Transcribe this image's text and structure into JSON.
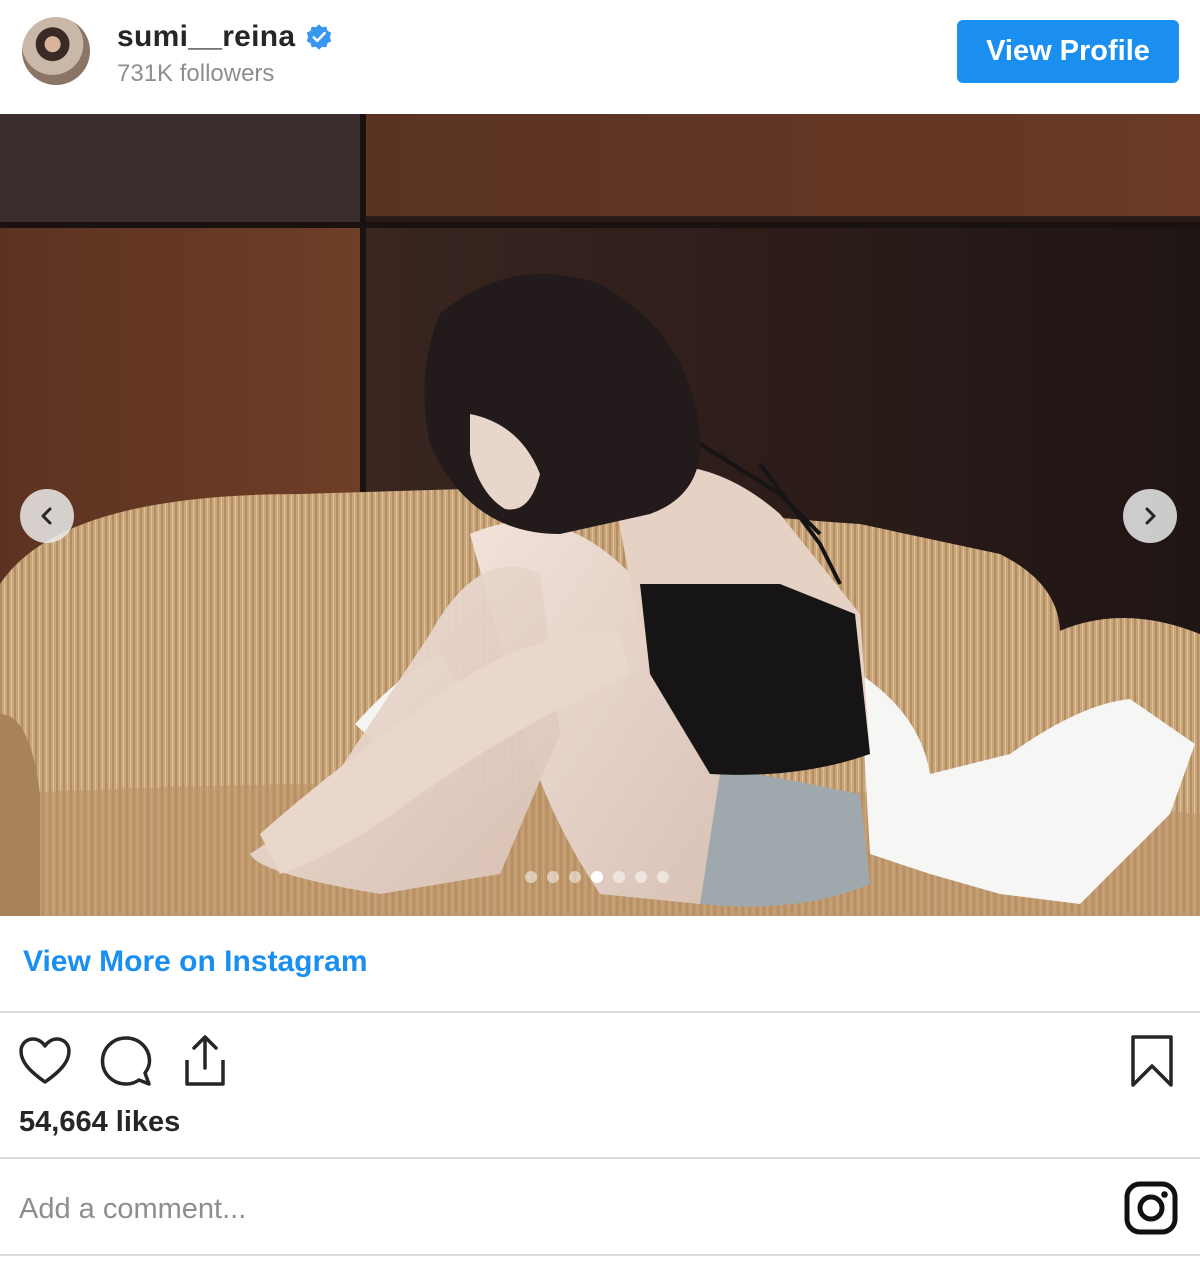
{
  "header": {
    "username": "sumi__reina",
    "followers": "731K followers",
    "verified_icon": "verified-badge-icon",
    "view_profile_label": "View Profile"
  },
  "post": {
    "carousel": {
      "total_slides": 7,
      "active_slide": 4
    },
    "view_more_label": "View More on Instagram",
    "likes": "54,664 likes",
    "comment_placeholder": "Add a comment..."
  },
  "icons": {
    "prev": "chevron-left-icon",
    "next": "chevron-right-icon",
    "like": "heart-icon",
    "comment": "comment-bubble-icon",
    "share": "share-icon",
    "save": "bookmark-icon",
    "brand": "instagram-logo-icon"
  },
  "colors": {
    "accent": "#1a8ff0",
    "text": "#262626",
    "muted": "#8e8e8e",
    "divider": "#dbdbdb"
  }
}
